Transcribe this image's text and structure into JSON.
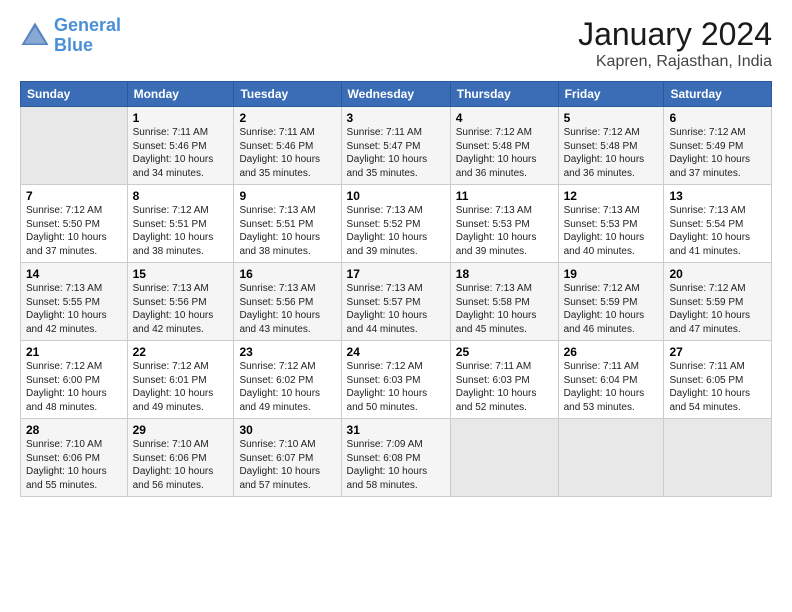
{
  "header": {
    "logo_line1": "General",
    "logo_line2": "Blue",
    "main_title": "January 2024",
    "subtitle": "Kapren, Rajasthan, India"
  },
  "columns": [
    "Sunday",
    "Monday",
    "Tuesday",
    "Wednesday",
    "Thursday",
    "Friday",
    "Saturday"
  ],
  "weeks": [
    [
      {
        "day": "",
        "info": ""
      },
      {
        "day": "1",
        "info": "Sunrise: 7:11 AM\nSunset: 5:46 PM\nDaylight: 10 hours\nand 34 minutes."
      },
      {
        "day": "2",
        "info": "Sunrise: 7:11 AM\nSunset: 5:46 PM\nDaylight: 10 hours\nand 35 minutes."
      },
      {
        "day": "3",
        "info": "Sunrise: 7:11 AM\nSunset: 5:47 PM\nDaylight: 10 hours\nand 35 minutes."
      },
      {
        "day": "4",
        "info": "Sunrise: 7:12 AM\nSunset: 5:48 PM\nDaylight: 10 hours\nand 36 minutes."
      },
      {
        "day": "5",
        "info": "Sunrise: 7:12 AM\nSunset: 5:48 PM\nDaylight: 10 hours\nand 36 minutes."
      },
      {
        "day": "6",
        "info": "Sunrise: 7:12 AM\nSunset: 5:49 PM\nDaylight: 10 hours\nand 37 minutes."
      }
    ],
    [
      {
        "day": "7",
        "info": "Sunrise: 7:12 AM\nSunset: 5:50 PM\nDaylight: 10 hours\nand 37 minutes."
      },
      {
        "day": "8",
        "info": "Sunrise: 7:12 AM\nSunset: 5:51 PM\nDaylight: 10 hours\nand 38 minutes."
      },
      {
        "day": "9",
        "info": "Sunrise: 7:13 AM\nSunset: 5:51 PM\nDaylight: 10 hours\nand 38 minutes."
      },
      {
        "day": "10",
        "info": "Sunrise: 7:13 AM\nSunset: 5:52 PM\nDaylight: 10 hours\nand 39 minutes."
      },
      {
        "day": "11",
        "info": "Sunrise: 7:13 AM\nSunset: 5:53 PM\nDaylight: 10 hours\nand 39 minutes."
      },
      {
        "day": "12",
        "info": "Sunrise: 7:13 AM\nSunset: 5:53 PM\nDaylight: 10 hours\nand 40 minutes."
      },
      {
        "day": "13",
        "info": "Sunrise: 7:13 AM\nSunset: 5:54 PM\nDaylight: 10 hours\nand 41 minutes."
      }
    ],
    [
      {
        "day": "14",
        "info": "Sunrise: 7:13 AM\nSunset: 5:55 PM\nDaylight: 10 hours\nand 42 minutes."
      },
      {
        "day": "15",
        "info": "Sunrise: 7:13 AM\nSunset: 5:56 PM\nDaylight: 10 hours\nand 42 minutes."
      },
      {
        "day": "16",
        "info": "Sunrise: 7:13 AM\nSunset: 5:56 PM\nDaylight: 10 hours\nand 43 minutes."
      },
      {
        "day": "17",
        "info": "Sunrise: 7:13 AM\nSunset: 5:57 PM\nDaylight: 10 hours\nand 44 minutes."
      },
      {
        "day": "18",
        "info": "Sunrise: 7:13 AM\nSunset: 5:58 PM\nDaylight: 10 hours\nand 45 minutes."
      },
      {
        "day": "19",
        "info": "Sunrise: 7:12 AM\nSunset: 5:59 PM\nDaylight: 10 hours\nand 46 minutes."
      },
      {
        "day": "20",
        "info": "Sunrise: 7:12 AM\nSunset: 5:59 PM\nDaylight: 10 hours\nand 47 minutes."
      }
    ],
    [
      {
        "day": "21",
        "info": "Sunrise: 7:12 AM\nSunset: 6:00 PM\nDaylight: 10 hours\nand 48 minutes."
      },
      {
        "day": "22",
        "info": "Sunrise: 7:12 AM\nSunset: 6:01 PM\nDaylight: 10 hours\nand 49 minutes."
      },
      {
        "day": "23",
        "info": "Sunrise: 7:12 AM\nSunset: 6:02 PM\nDaylight: 10 hours\nand 49 minutes."
      },
      {
        "day": "24",
        "info": "Sunrise: 7:12 AM\nSunset: 6:03 PM\nDaylight: 10 hours\nand 50 minutes."
      },
      {
        "day": "25",
        "info": "Sunrise: 7:11 AM\nSunset: 6:03 PM\nDaylight: 10 hours\nand 52 minutes."
      },
      {
        "day": "26",
        "info": "Sunrise: 7:11 AM\nSunset: 6:04 PM\nDaylight: 10 hours\nand 53 minutes."
      },
      {
        "day": "27",
        "info": "Sunrise: 7:11 AM\nSunset: 6:05 PM\nDaylight: 10 hours\nand 54 minutes."
      }
    ],
    [
      {
        "day": "28",
        "info": "Sunrise: 7:10 AM\nSunset: 6:06 PM\nDaylight: 10 hours\nand 55 minutes."
      },
      {
        "day": "29",
        "info": "Sunrise: 7:10 AM\nSunset: 6:06 PM\nDaylight: 10 hours\nand 56 minutes."
      },
      {
        "day": "30",
        "info": "Sunrise: 7:10 AM\nSunset: 6:07 PM\nDaylight: 10 hours\nand 57 minutes."
      },
      {
        "day": "31",
        "info": "Sunrise: 7:09 AM\nSunset: 6:08 PM\nDaylight: 10 hours\nand 58 minutes."
      },
      {
        "day": "",
        "info": ""
      },
      {
        "day": "",
        "info": ""
      },
      {
        "day": "",
        "info": ""
      }
    ]
  ]
}
